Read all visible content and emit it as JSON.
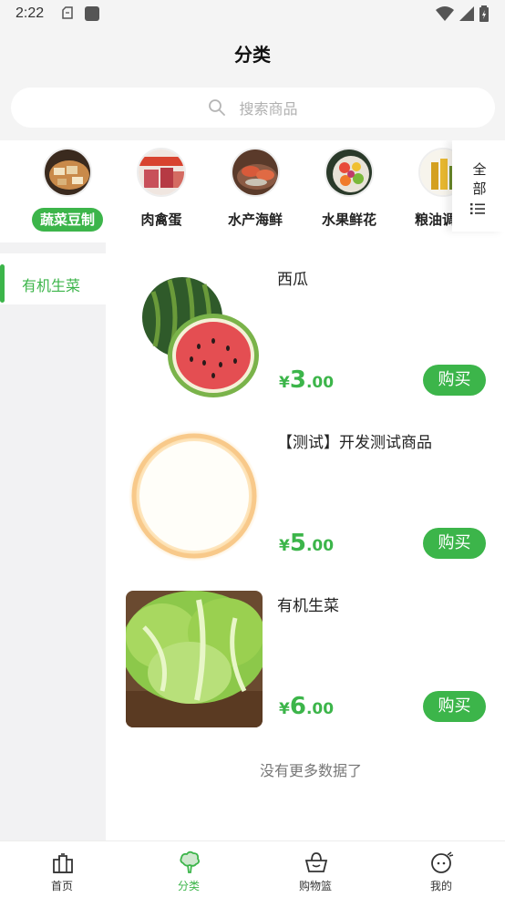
{
  "status_bar": {
    "time": "2:22"
  },
  "header": {
    "title": "分类"
  },
  "search": {
    "placeholder": "搜索商品"
  },
  "categories": [
    {
      "label": "蔬菜豆制",
      "active": true
    },
    {
      "label": "肉禽蛋",
      "active": false
    },
    {
      "label": "水产海鲜",
      "active": false
    },
    {
      "label": "水果鲜花",
      "active": false
    },
    {
      "label": "粮油调",
      "active": false
    }
  ],
  "all_categories": {
    "label": "全部"
  },
  "sidebar": {
    "items": [
      {
        "label": "有机生菜",
        "active": true
      }
    ]
  },
  "products": [
    {
      "name": "西瓜",
      "currency": "¥",
      "price_int": "3",
      "price_dec": ".00",
      "buy_label": "购买",
      "image": "watermelon"
    },
    {
      "name": "【测试】开发测试商品",
      "currency": "¥",
      "price_int": "5",
      "price_dec": ".00",
      "buy_label": "购买",
      "image": "plate"
    },
    {
      "name": "有机生菜",
      "currency": "¥",
      "price_int": "6",
      "price_dec": ".00",
      "buy_label": "购买",
      "image": "lettuce"
    }
  ],
  "list_end_text": "没有更多数据了",
  "tabbar": {
    "items": [
      {
        "label": "首页",
        "icon": "home-icon",
        "active": false
      },
      {
        "label": "分类",
        "icon": "category-icon",
        "active": true
      },
      {
        "label": "购物篮",
        "icon": "basket-icon",
        "active": false
      },
      {
        "label": "我的",
        "icon": "profile-icon",
        "active": false
      }
    ]
  },
  "colors": {
    "accent": "#3cb54a",
    "background": "#f2f2f3"
  }
}
